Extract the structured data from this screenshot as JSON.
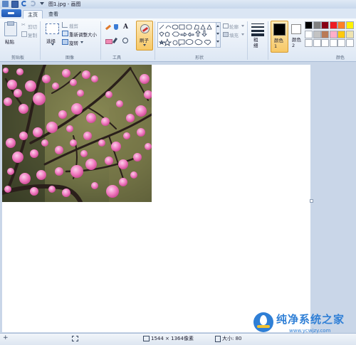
{
  "window": {
    "title": "图1.jpg - 画图"
  },
  "tabs": [
    {
      "label": "主页"
    },
    {
      "label": "查看"
    }
  ],
  "clipboard": {
    "paste_label": "粘贴",
    "cut_label": "剪切",
    "copy_label": "复制",
    "group_label": "剪贴板"
  },
  "image": {
    "select_label": "选择",
    "crop_label": "裁剪",
    "resize_label": "重新调整大小",
    "rotate_label": "旋转",
    "group_label": "图像"
  },
  "tools": {
    "group_label": "工具",
    "brush_label": "刷子"
  },
  "shapes": {
    "outline_label": "轮廓",
    "fill_label": "填充",
    "group_label": "形状"
  },
  "size": {
    "label": "粗细"
  },
  "colors": {
    "color1_label": "颜色 1",
    "color2_label": "颜色 2",
    "group_label": "颜色",
    "color1": "#000000",
    "color2": "#ffffff",
    "palette_row1": [
      "#000000",
      "#7f7f7f",
      "#880015",
      "#ed1c24",
      "#ff7f27",
      "#fff200"
    ],
    "palette_row2": [
      "#ffffff",
      "#c3c3c3",
      "#b97a57",
      "#ffaec9",
      "#ffc90e",
      "#efe4b0"
    ]
  },
  "status": {
    "dimensions": "1544 × 1364像素",
    "size_label": "大小: 80"
  },
  "watermark": {
    "text": "纯净系统之家",
    "url": "www.ycwjzy.com"
  }
}
